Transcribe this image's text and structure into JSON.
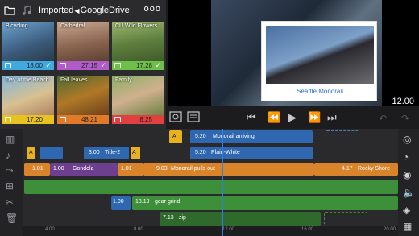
{
  "browser": {
    "title_part1": "Imported",
    "title_part2": "GoogleDrive",
    "more": "ooo",
    "thumbs": [
      {
        "label": "Bicycling",
        "duration": "18.00",
        "bar_color": "#3fa9e0",
        "checked": true
      },
      {
        "label": "Cathedral",
        "duration": "27.15",
        "bar_color": "#b05cc8",
        "checked": true
      },
      {
        "label": "CU Wild Flowers",
        "duration": "17.28",
        "bar_color": "#6ec04a",
        "checked": true
      },
      {
        "label": "Day at the Beach",
        "duration": "17.20",
        "bar_color": "#e8c21e",
        "checked": false
      },
      {
        "label": "Fall leaves",
        "duration": "48.21",
        "bar_color": "#e07a2a",
        "checked": false
      },
      {
        "label": "Family",
        "duration": "8.25",
        "bar_color": "#e04040",
        "checked": false
      }
    ]
  },
  "preview": {
    "caption": "Seattle Monorail",
    "time": "12.00"
  },
  "transport": {
    "skip_back": "⏮",
    "step_back": "⏪",
    "play": "▶",
    "step_fwd": "⏩",
    "skip_fwd": "⏭"
  },
  "timeline": {
    "clips": {
      "t_a": "A",
      "t_time1": "5.20",
      "t_title1": "Monorail arriving",
      "t_a2": "A",
      "t_a3": "A",
      "t_time2": "3.00",
      "t_title2": "Title-2",
      "t_time3": "5.20",
      "t_title3": "Plain-White",
      "v_time1": "1.01",
      "v_time2": "1.00",
      "v_label2": "Gondola",
      "v_time3": "1.01",
      "v_time4": "9.03",
      "v_label4": "Monorail pulls out",
      "v_time5": "4.17",
      "v_label5": "Rocky Shore",
      "a_time1": "1.00",
      "a_time2": "18.19",
      "a_label2": "gear grind",
      "a_time3": "7.13",
      "a_label3": "zip"
    },
    "ruler": [
      "4.00",
      "8.00",
      "12.00",
      "16.00",
      "20.00"
    ]
  }
}
